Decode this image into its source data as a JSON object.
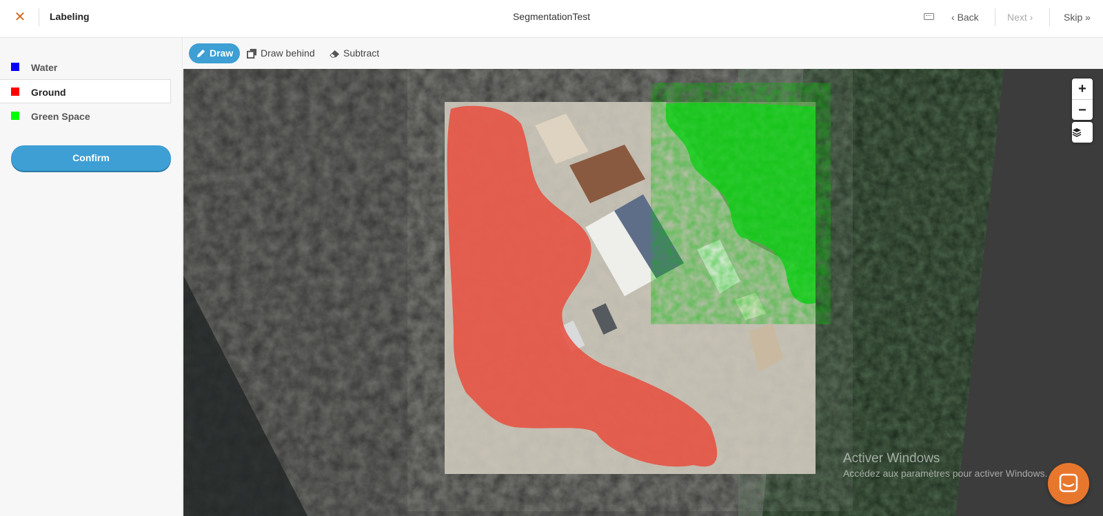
{
  "header": {
    "close_icon": "close-icon",
    "app_title": "Labeling",
    "project_title": "SegmentationTest",
    "keyboard_icon": "keyboard-icon",
    "back_label": "Back",
    "next_label": "Next",
    "skip_label": "Skip"
  },
  "sidebar": {
    "classes": [
      {
        "label": "Water",
        "color": "#0000ff",
        "selected": false
      },
      {
        "label": "Ground",
        "color": "#ff0000",
        "selected": true
      },
      {
        "label": "Green Space",
        "color": "#00ff00",
        "selected": false
      }
    ],
    "confirm_label": "Confirm"
  },
  "toolbar": {
    "tools": [
      {
        "label": "Draw",
        "icon": "pencil-icon",
        "active": true
      },
      {
        "label": "Draw behind",
        "icon": "layers-copy-icon",
        "active": false
      },
      {
        "label": "Subtract",
        "icon": "eraser-icon",
        "active": false
      }
    ]
  },
  "map_controls": {
    "zoom_in": "+",
    "zoom_out": "−",
    "layers_icon": "layers-icon"
  },
  "watermark": {
    "line1": "Activer Windows",
    "line2": "Accédez aux paramètres pour activer Windows."
  },
  "colors": {
    "accent": "#3d9fd4",
    "close": "#d06a22",
    "chat": "#e8772e"
  }
}
